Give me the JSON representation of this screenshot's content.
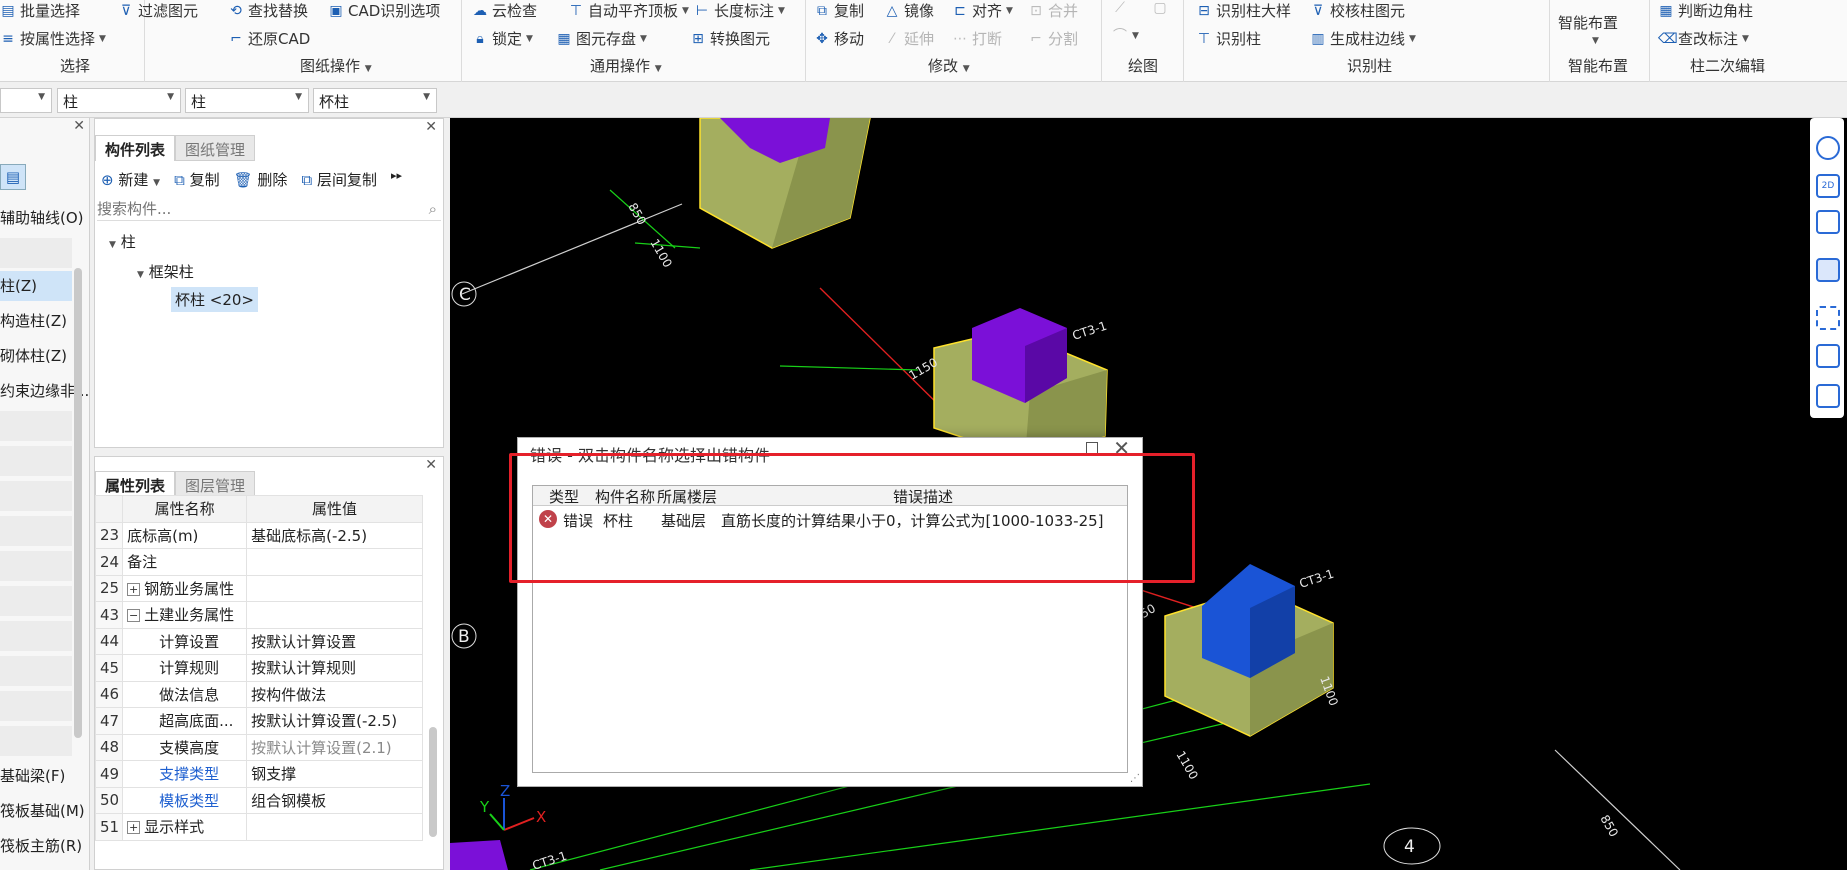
{
  "ribbon": {
    "select": {
      "label": "选择",
      "batch": "批量选择",
      "filter": "过滤图元",
      "by_attr": "按属性选择"
    },
    "drawing_ops": {
      "label": "图纸操作",
      "find_replace": "查找替换",
      "cad_options": "CAD识别选项",
      "restore_cad": "还原CAD"
    },
    "common_ops": {
      "label": "通用操作",
      "cloud_check": "云检查",
      "auto_align": "自动平齐顶板",
      "length_mark": "长度标注",
      "lock": "锁定",
      "save_element": "图元存盘",
      "convert": "转换图元"
    },
    "modify": {
      "label": "修改",
      "copy": "复制",
      "mirror": "镜像",
      "align": "对齐",
      "merge": "合并",
      "move": "移动",
      "extend": "延伸",
      "break": "打断",
      "split": "分割"
    },
    "draw": {
      "label": "绘图"
    },
    "recognize_column": {
      "label": "识别柱",
      "col_table": "识别柱大样",
      "check_col": "校核柱图元",
      "recognize": "识别柱",
      "gen_edge": "生成柱边线"
    },
    "smart": {
      "label": "智能布置",
      "btn": "智能布置"
    },
    "col_edit": {
      "label": "柱二次编辑",
      "corner": "判断边角柱",
      "check_mark": "查改标注"
    }
  },
  "combos": [
    "",
    "柱",
    "柱",
    "杯柱"
  ],
  "left_list": [
    "辅助轴线(O)",
    "柱(Z)",
    "构造柱(Z)",
    "砌体柱(Z)",
    "约束边缘非...",
    "基础梁(F)",
    "筏板基础(M)",
    "筏板主筋(R)"
  ],
  "component_panel": {
    "tabs": [
      "构件列表",
      "图纸管理"
    ],
    "toolbar": {
      "new": "新建",
      "copy": "复制",
      "delete": "删除",
      "layer_copy": "层间复制"
    },
    "search_placeholder": "搜索构件...",
    "tree": {
      "root": "柱",
      "child": "框架柱",
      "leaf": "杯柱 <20>"
    }
  },
  "property_panel": {
    "tabs": [
      "属性列表",
      "图层管理"
    ],
    "headers": [
      "属性名称",
      "属性值"
    ],
    "rows": [
      {
        "no": "23",
        "name": "底标高(m)",
        "value": "基础底标高(-2.5)"
      },
      {
        "no": "24",
        "name": "备注",
        "value": ""
      },
      {
        "no": "25",
        "name": "钢筋业务属性",
        "value": ""
      },
      {
        "no": "43",
        "name": "土建业务属性",
        "value": ""
      },
      {
        "no": "44",
        "name": "计算设置",
        "value": "按默认计算设置"
      },
      {
        "no": "45",
        "name": "计算规则",
        "value": "按默认计算规则"
      },
      {
        "no": "46",
        "name": "做法信息",
        "value": "按构件做法"
      },
      {
        "no": "47",
        "name": "超高底面...",
        "value": "按默认计算设置(-2.5)"
      },
      {
        "no": "48",
        "name": "支模高度",
        "value": "按默认计算设置(2.1)"
      },
      {
        "no": "49",
        "name": "支撑类型",
        "value": "钢支撑"
      },
      {
        "no": "50",
        "name": "模板类型",
        "value": "组合钢模板"
      },
      {
        "no": "51",
        "name": "显示样式",
        "value": ""
      }
    ]
  },
  "canvas": {
    "axis_c": "C",
    "axis_b": "B",
    "axis_4": "4",
    "tag": "CT3-1",
    "dim1": "1150",
    "dim2": "850",
    "dim3": "1100",
    "gizmo": {
      "x": "X",
      "y": "Y",
      "z": "Z"
    }
  },
  "dialog": {
    "title": "错误 - 双击构件名称选择出错构件",
    "headers": {
      "type": "类型",
      "name": "构件名称",
      "floor": "所属楼层",
      "desc": "错误描述"
    },
    "row": {
      "type": "错误",
      "name": "杯柱",
      "floor": "基础层",
      "desc": "直筋长度的计算结果小于0，计算公式为[1000-1033-25]"
    }
  },
  "colors": {
    "highlight": "#e5202a",
    "canvas": "#000000",
    "purple": "#7b10d8",
    "blue": "#1a54d6",
    "olive": "#a4ae5f"
  }
}
